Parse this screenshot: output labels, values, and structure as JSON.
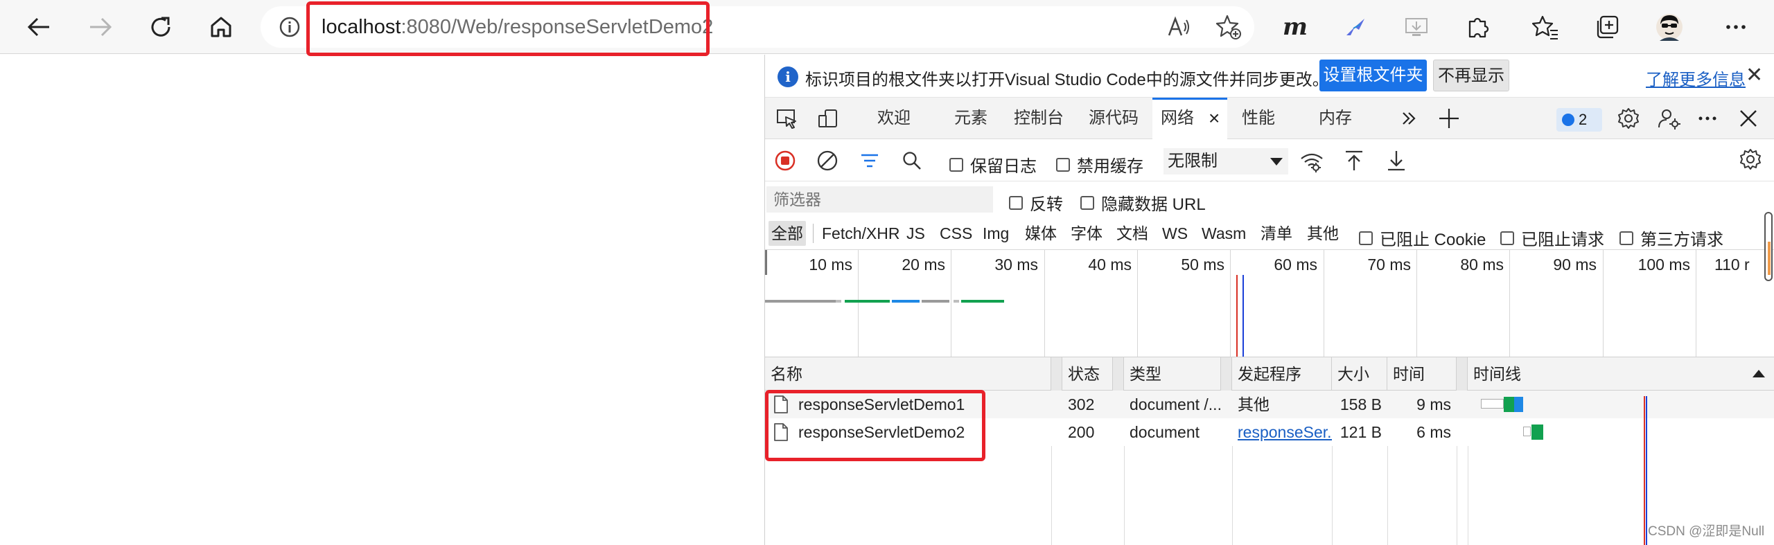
{
  "browser": {
    "url_host": "localhost",
    "url_path": ":8080/Web/responseServletDemo2"
  },
  "devtools": {
    "infobar": {
      "text": "标识项目的根文件夹以打开Visual Studio Code中的源文件并同步更改。",
      "primary_button": "设置根文件夹",
      "secondary_button": "不再显示",
      "link": "了解更多信息"
    },
    "tabs": [
      {
        "label": "欢迎",
        "active": false
      },
      {
        "label": "元素",
        "active": false
      },
      {
        "label": "控制台",
        "active": false
      },
      {
        "label": "源代码",
        "active": false
      },
      {
        "label": "网络",
        "active": true
      },
      {
        "label": "性能",
        "active": false
      },
      {
        "label": "内存",
        "active": false
      }
    ],
    "issues_count": "2",
    "toolbar": {
      "preserve_log": "保留日志",
      "disable_cache": "禁用缓存",
      "throttle": "无限制"
    },
    "filter": {
      "placeholder": "筛选器",
      "invert": "反转",
      "hide_data_urls": "隐藏数据 URL"
    },
    "types": [
      "全部",
      "Fetch/XHR",
      "JS",
      "CSS",
      "Img",
      "媒体",
      "字体",
      "文档",
      "WS",
      "Wasm",
      "清单",
      "其他"
    ],
    "type_checks": [
      "已阻止 Cookie",
      "已阻止请求",
      "第三方请求"
    ],
    "overview_ticks": [
      "10 ms",
      "20 ms",
      "30 ms",
      "40 ms",
      "50 ms",
      "60 ms",
      "70 ms",
      "80 ms",
      "90 ms",
      "100 ms",
      "110 r"
    ],
    "columns": [
      "名称",
      "状态",
      "类型",
      "发起程序",
      "大小",
      "时间",
      "时间线"
    ],
    "rows": [
      {
        "name": "responseServletDemo1",
        "status": "302",
        "type": "document /...",
        "initiator": "其他",
        "initiator_is_link": false,
        "size": "158 B",
        "time": "9 ms"
      },
      {
        "name": "responseServletDemo2",
        "status": "200",
        "type": "document",
        "initiator": "responseSer...",
        "initiator_is_link": true,
        "size": "121 B",
        "time": "6 ms"
      }
    ]
  },
  "watermark": "CSDN @涩即是Null",
  "colors": {
    "highlight": "#e8212a",
    "accent": "#1a73e8",
    "record": "#d93025",
    "timing_green": "#12a150",
    "timing_blue": "#1e88e5"
  }
}
